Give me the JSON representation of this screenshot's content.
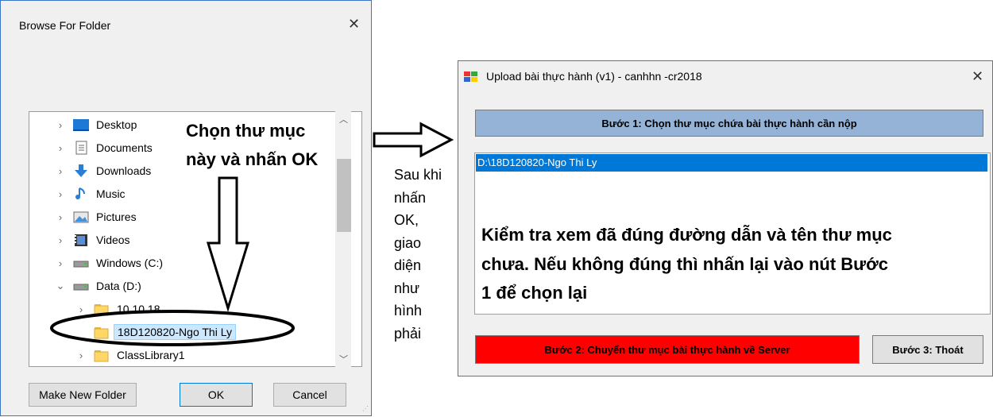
{
  "browse_dialog": {
    "title": "Browse For Folder",
    "close_glyph": "✕",
    "tree": [
      {
        "label": "Desktop",
        "icon": "desktop-icon"
      },
      {
        "label": "Documents",
        "icon": "documents-icon"
      },
      {
        "label": "Downloads",
        "icon": "downloads-icon"
      },
      {
        "label": "Music",
        "icon": "music-icon"
      },
      {
        "label": "Pictures",
        "icon": "pictures-icon"
      },
      {
        "label": "Videos",
        "icon": "videos-icon"
      },
      {
        "label": "Windows (C:)",
        "icon": "drive-icon"
      },
      {
        "label": "Data (D:)",
        "icon": "drive-icon"
      },
      {
        "label": "10.10.18",
        "icon": "folder-icon"
      },
      {
        "label": "18D120820-Ngo Thi Ly",
        "icon": "folder-icon"
      },
      {
        "label": "ClassLibrary1",
        "icon": "folder-icon"
      }
    ],
    "buttons": {
      "new_folder": "Make New Folder",
      "ok": "OK",
      "cancel": "Cancel"
    }
  },
  "annotations": {
    "choose_line1": "Chọn thư mục",
    "choose_line2": "này và nhấn OK",
    "after_ok": [
      "Sau khi",
      "nhấn",
      "OK,",
      "giao",
      "diện",
      "như",
      "hình",
      "phải"
    ],
    "check_line1": "Kiểm tra xem đã đúng đường dẫn và tên thư mục",
    "check_line2": "chưa. Nếu không đúng thì nhấn lại vào nút Bước",
    "check_line3": "1 để chọn lại"
  },
  "upload_window": {
    "title": "Upload bài thực hành (v1) - canhhn -cr2018",
    "close_glyph": "✕",
    "step1_label": "Bước 1: Chọn thư mục chứa bài thực hành cần nộp",
    "selected_path": "D:\\18D120820-Ngo Thi Ly",
    "step2_label": "Bước 2: Chuyển thư mục bài thực hành về Server",
    "step3_label": "Bước 3: Thoát"
  },
  "colors": {
    "accent": "#0078d7",
    "step1_bg": "#95b3d7",
    "step2_bg": "#ff0000",
    "folder": "#ffd769"
  }
}
